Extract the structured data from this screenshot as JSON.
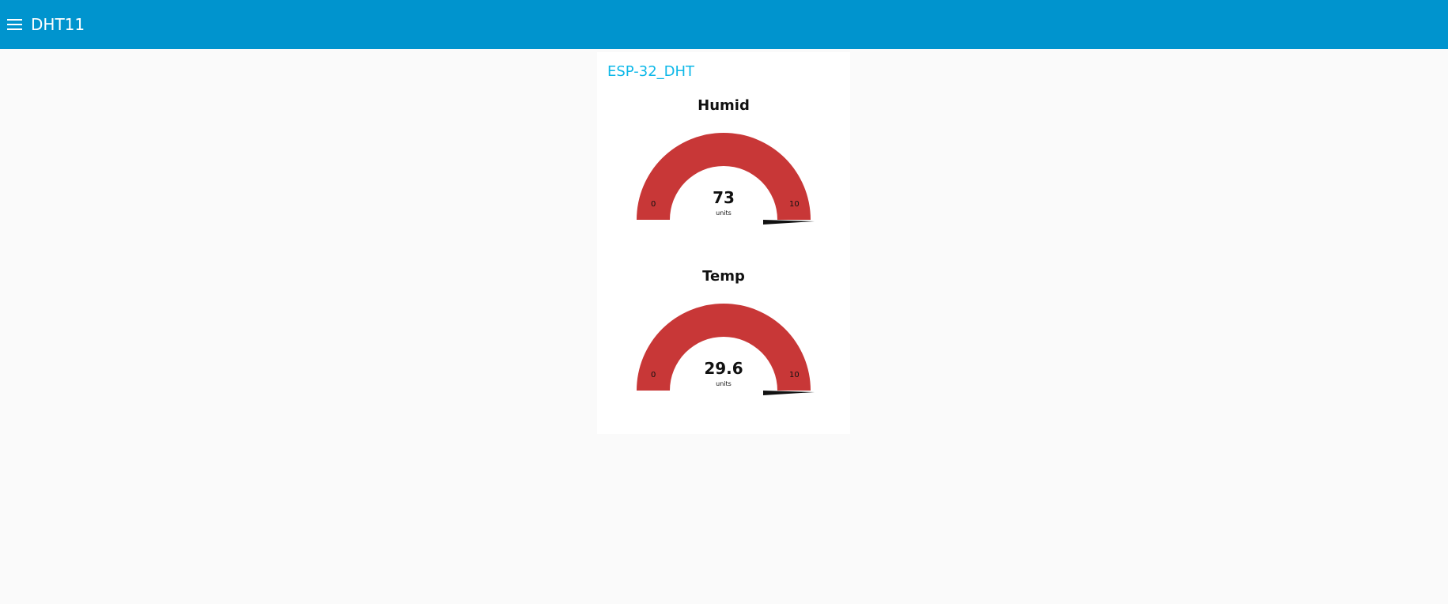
{
  "toolbar": {
    "title": "DHT11",
    "menu_icon": "menu-icon",
    "color": "#0094ce"
  },
  "group": {
    "title": "ESP-32_DHT",
    "title_color": "#0eb8e8"
  },
  "gauges": [
    {
      "title": "Humid",
      "value": "73",
      "units": "units",
      "min": "0",
      "max": "10",
      "fill_fraction": 1,
      "color": "#c83737"
    },
    {
      "title": "Temp",
      "value": "29.6",
      "units": "units",
      "min": "0",
      "max": "10",
      "fill_fraction": 1,
      "color": "#c83737"
    }
  ]
}
